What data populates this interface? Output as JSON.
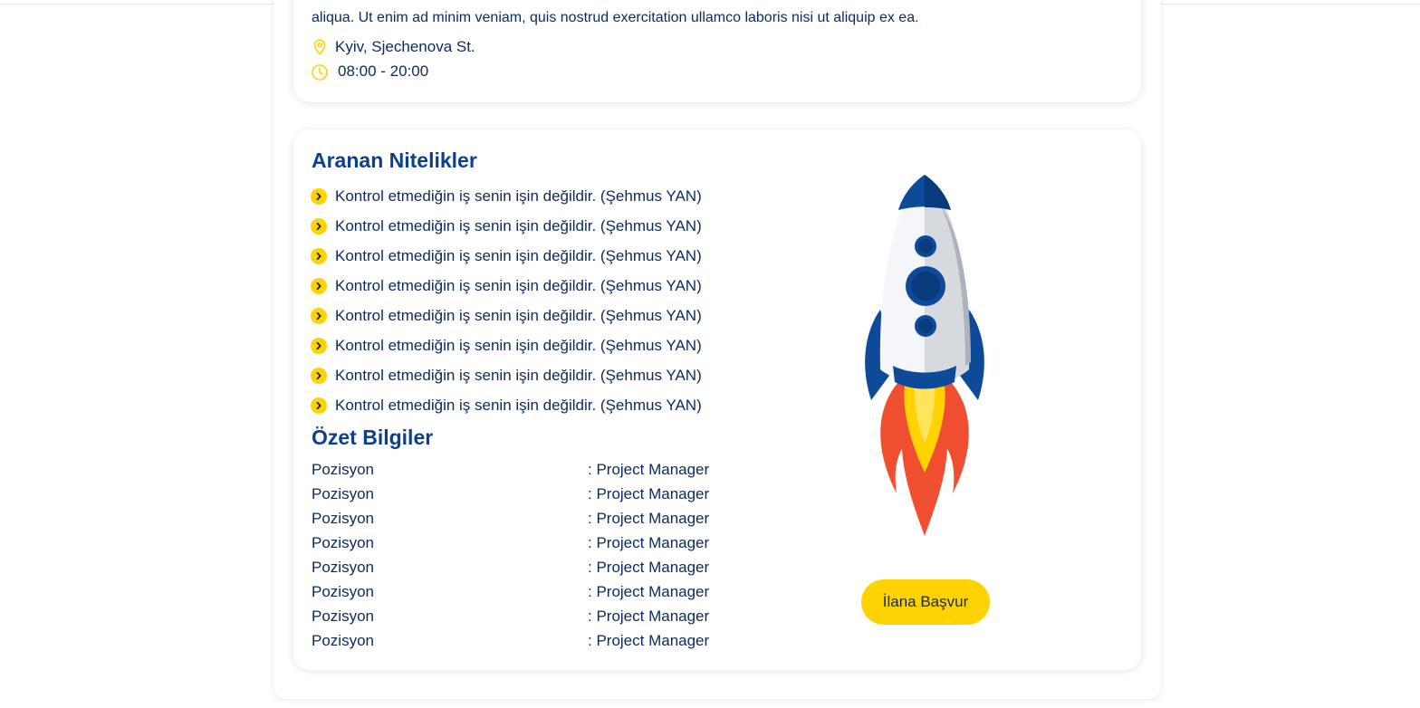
{
  "job": {
    "description_tail": "aliqua. Ut enim ad minim veniam, quis nostrud exercitation ullamco laboris nisi ut aliquip ex ea.",
    "location": "Kyiv, Sjechenova St.",
    "hours": "08:00 - 20:00"
  },
  "qualifications": {
    "title": "Aranan Nitelikler",
    "items": [
      "Kontrol etmediğin iş senin işin değildir. (Şehmus YAN)",
      "Kontrol etmediğin iş senin işin değildir. (Şehmus YAN)",
      "Kontrol etmediğin iş senin işin değildir. (Şehmus YAN)",
      "Kontrol etmediğin iş senin işin değildir. (Şehmus YAN)",
      "Kontrol etmediğin iş senin işin değildir. (Şehmus YAN)",
      "Kontrol etmediğin iş senin işin değildir. (Şehmus YAN)",
      "Kontrol etmediğin iş senin işin değildir. (Şehmus YAN)",
      "Kontrol etmediğin iş senin işin değildir. (Şehmus YAN)"
    ]
  },
  "summary": {
    "title": "Özet Bilgiler",
    "rows": [
      {
        "key": "Pozisyon",
        "value": ": Project Manager"
      },
      {
        "key": "Pozisyon",
        "value": ": Project Manager"
      },
      {
        "key": "Pozisyon",
        "value": ": Project Manager"
      },
      {
        "key": "Pozisyon",
        "value": ": Project Manager"
      },
      {
        "key": "Pozisyon",
        "value": ": Project Manager"
      },
      {
        "key": "Pozisyon",
        "value": ": Project Manager"
      },
      {
        "key": "Pozisyon",
        "value": ": Project Manager"
      },
      {
        "key": "Pozisyon",
        "value": ": Project Manager"
      }
    ]
  },
  "apply_button": {
    "label": "İlana Başvur"
  },
  "icons": {
    "location": "map-pin-icon",
    "clock": "clock-icon",
    "bullet": "chevron-right-circle-icon",
    "illustration": "rocket-illustration"
  },
  "colors": {
    "accent": "#ffd200",
    "heading": "#0d3f8f",
    "text": "#0b2a5c"
  }
}
